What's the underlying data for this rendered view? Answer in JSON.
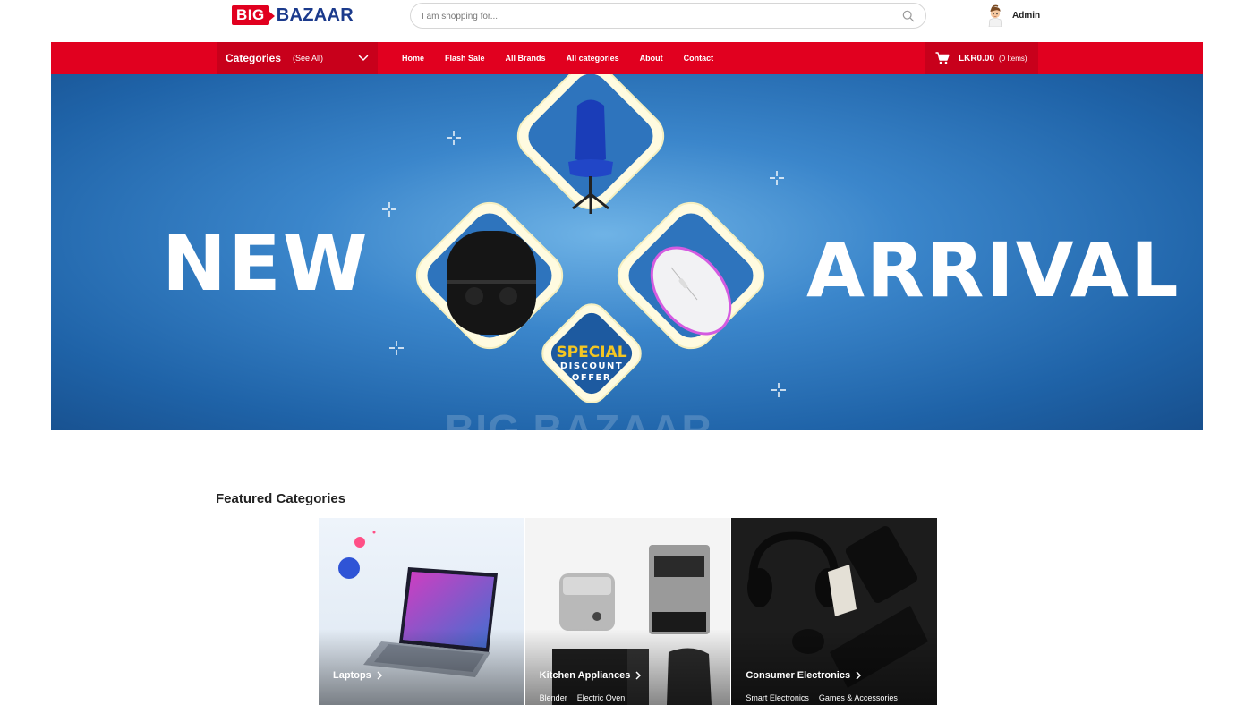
{
  "brand": {
    "logo_big": "BIG",
    "logo_bazaar": "BAZAAR"
  },
  "search": {
    "placeholder": "I am shopping for...",
    "value": ""
  },
  "user": {
    "name": "Admin"
  },
  "nav": {
    "categories_label": "Categories",
    "categories_see_all": "(See All)",
    "links": [
      "Home",
      "Flash Sale",
      "All Brands",
      "All categories",
      "About",
      "Contact"
    ],
    "cart_total": "LKR0.00",
    "cart_items": "(0 Items)"
  },
  "hero": {
    "left_text": "NEW",
    "right_text": "ARRIVAL",
    "badge_line1": "SPECIAL",
    "badge_line2": "DISCOUNT",
    "badge_line3": "OFFER",
    "watermark": "BIG BAZAAR"
  },
  "featured": {
    "title": "Featured Categories",
    "cards": [
      {
        "title": "Laptops",
        "subs": []
      },
      {
        "title": "Kitchen Appliances",
        "subs": [
          "Blender",
          "Electric Oven"
        ]
      },
      {
        "title": "Consumer Electronics",
        "subs": [
          "Smart Electronics",
          "Games & Accessories"
        ]
      }
    ]
  },
  "colors": {
    "brand_red": "#e1001f",
    "brand_dark_red": "#c8001b",
    "brand_blue": "#1b3a8c",
    "hero_blue": "#2f7bc2",
    "badge_yellow": "#f3c623"
  },
  "icons": [
    "search-icon",
    "avatar",
    "chevron-down-icon",
    "cart-icon",
    "chevron-right-icon",
    "sparkle-icon"
  ]
}
